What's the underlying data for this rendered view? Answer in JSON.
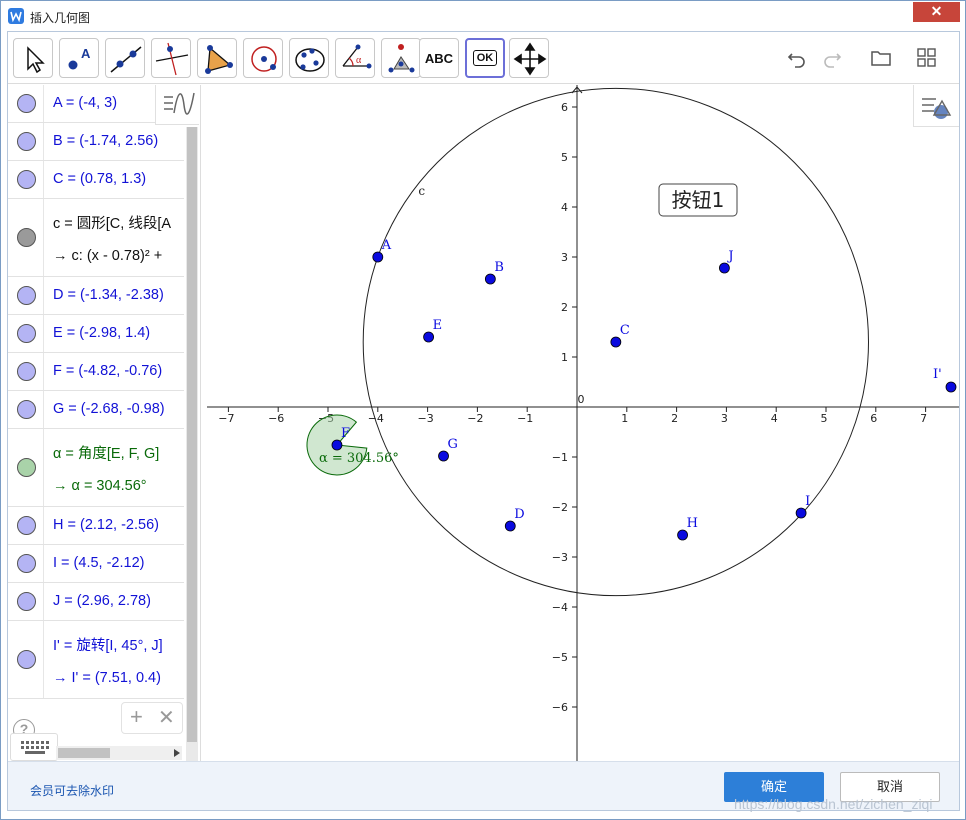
{
  "window": {
    "title": "插入几何图",
    "close_glyph": "✕"
  },
  "toolbar": {
    "tools": [
      {
        "name": "move-tool-icon",
        "selected": false
      },
      {
        "name": "point-tool-icon",
        "label": "A",
        "selected": false
      },
      {
        "name": "line-tool-icon",
        "selected": false
      },
      {
        "name": "perpendicular-tool-icon",
        "selected": false
      },
      {
        "name": "polygon-tool-icon",
        "selected": false
      },
      {
        "name": "circle-tool-icon",
        "selected": false
      },
      {
        "name": "conic-tool-icon",
        "selected": false
      },
      {
        "name": "angle-tool-icon",
        "label": "α",
        "selected": false
      },
      {
        "name": "reflect-tool-icon",
        "selected": false
      },
      {
        "name": "text-tool",
        "label": "ABC",
        "selected": false
      },
      {
        "name": "button-tool",
        "label": "OK",
        "selected": true
      },
      {
        "name": "move-view-tool-icon",
        "selected": false
      }
    ],
    "right_icons": [
      "undo-icon",
      "redo-icon",
      "folder-icon",
      "grid-menu-icon"
    ]
  },
  "algebra": {
    "rows": [
      {
        "text": "A = (-4, 3)",
        "color": "blue"
      },
      {
        "text": "B = (-1.74, 2.56)",
        "color": "blue"
      },
      {
        "text": "C = (0.78, 1.3)",
        "color": "blue"
      },
      {
        "text": "c = 圆形[C, 线段[A",
        "sub": "→   c: (x - 0.78)² +",
        "color": "black"
      },
      {
        "text": "D = (-1.34, -2.38)",
        "color": "blue"
      },
      {
        "text": "E = (-2.98, 1.4)",
        "color": "blue"
      },
      {
        "text": "F = (-4.82, -0.76)",
        "color": "blue"
      },
      {
        "text": "G = (-2.68, -0.98)",
        "color": "blue"
      },
      {
        "text": "α = 角度[E, F, G]",
        "sub": "→   α = 304.56°",
        "color": "green"
      },
      {
        "text": "H = (2.12, -2.56)",
        "color": "blue"
      },
      {
        "text": "I = (4.5, -2.12)",
        "color": "blue"
      },
      {
        "text": "J = (2.96, 2.78)",
        "color": "blue"
      },
      {
        "text": "I' = 旋转[I, 45°, J]",
        "sub": "→   I' = (7.51, 0.4)",
        "color": "blue"
      }
    ],
    "colors": {
      "blue": "#1212d6",
      "green": "#0a6a0a",
      "black": "#111111",
      "point_fill": "#b4b4f4",
      "angle_fill": "#a9d3a9",
      "circle_fill": "#9a9a9a"
    },
    "help_glyph": "?",
    "add_glyph": "+",
    "delete_glyph": "✕"
  },
  "graphics": {
    "x_ticks": [
      "−7",
      "−6",
      "−5",
      "−4",
      "−3",
      "−2",
      "−1",
      "0",
      "1",
      "2",
      "3",
      "4",
      "5",
      "6",
      "7"
    ],
    "y_ticks": [
      "6",
      "5",
      "4",
      "3",
      "2",
      "1",
      "−1",
      "−2",
      "−3",
      "−4",
      "−5",
      "−6"
    ],
    "points": [
      {
        "label": "A",
        "x": -4,
        "y": 3
      },
      {
        "label": "B",
        "x": -1.74,
        "y": 2.56
      },
      {
        "label": "C",
        "x": 0.78,
        "y": 1.3
      },
      {
        "label": "D",
        "x": -1.34,
        "y": -2.38
      },
      {
        "label": "E",
        "x": -2.98,
        "y": 1.4
      },
      {
        "label": "F",
        "x": -4.82,
        "y": -0.76
      },
      {
        "label": "G",
        "x": -2.68,
        "y": -0.98
      },
      {
        "label": "H",
        "x": 2.12,
        "y": -2.56
      },
      {
        "label": "I",
        "x": 4.5,
        "y": -2.12
      },
      {
        "label": "J",
        "x": 2.96,
        "y": 2.78
      },
      {
        "label": "I'",
        "x": 7.51,
        "y": 0.4
      }
    ],
    "circle_label": "c",
    "angle_label": "α = 304.56°",
    "button_label": "按钮1",
    "point_color": "#0a0adf",
    "angle_color": "#0a6a0a"
  },
  "footer": {
    "watermark_link": "会员可去除水印",
    "ok_label": "确定",
    "cancel_label": "取消",
    "blog_watermark": "https://blog.csdn.net/zichen_ziqi"
  }
}
